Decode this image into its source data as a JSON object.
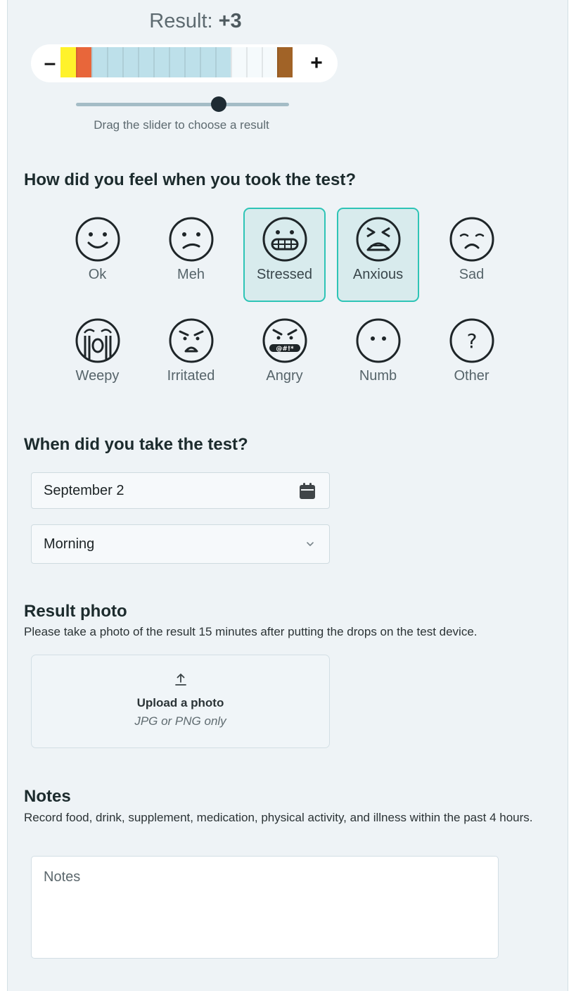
{
  "result": {
    "label": "Result:",
    "value": "+3",
    "minus_label": "–",
    "plus_label": "+",
    "strip_colors": [
      "#fff22b",
      "#e8663a",
      "#bde0ea",
      "#bde0ea",
      "#bde0ea",
      "#bde0ea",
      "#bde0ea",
      "#bde0ea",
      "#bde0ea",
      "#bde0ea",
      "#bde0ea",
      "#f5fafc",
      "#f5fafc",
      "#f5fafc",
      "#a16327"
    ],
    "slider_value_fraction": 0.67,
    "slider_hint": "Drag the slider to choose a result"
  },
  "feeling": {
    "question": "How did you feel when you took the test?",
    "moods": [
      {
        "label": "Ok",
        "icon": "smile",
        "selected": false
      },
      {
        "label": "Meh",
        "icon": "meh",
        "selected": false
      },
      {
        "label": "Stressed",
        "icon": "grimace",
        "selected": true
      },
      {
        "label": "Anxious",
        "icon": "anxious",
        "selected": true
      },
      {
        "label": "Sad",
        "icon": "sad",
        "selected": false
      },
      {
        "label": "Weepy",
        "icon": "weepy",
        "selected": false
      },
      {
        "label": "Irritated",
        "icon": "irritated",
        "selected": false
      },
      {
        "label": "Angry",
        "icon": "angry",
        "selected": false
      },
      {
        "label": "Numb",
        "icon": "numb",
        "selected": false
      },
      {
        "label": "Other",
        "icon": "question",
        "selected": false
      }
    ],
    "angry_mouth_text": "@#!*",
    "other_glyph": "?"
  },
  "when": {
    "question": "When did you take the test?",
    "date_value": "September 2",
    "time_value": "Morning"
  },
  "photo": {
    "title": "Result photo",
    "description": "Please take a photo of the result 15 minutes after putting the drops on the test device.",
    "upload_label": "Upload a photo",
    "upload_sub": "JPG or PNG only"
  },
  "notes": {
    "title": "Notes",
    "description": "Record food, drink, supplement, medication, physical activity, and illness within the past 4 hours.",
    "placeholder": "Notes"
  },
  "colors": {
    "panel_bg": "#eef3f6",
    "accent": "#2ec4b6",
    "selected_bg": "#d8ebed",
    "slider_thumb": "#1e2b33"
  }
}
